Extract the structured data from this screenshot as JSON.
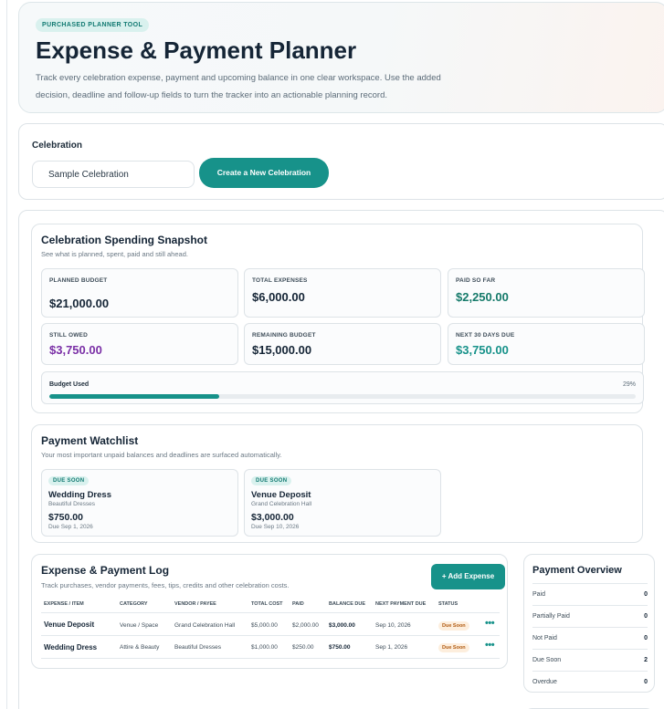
{
  "hero": {
    "pill": "PURCHASED PLANNER TOOL",
    "title": "Expense & Payment Planner",
    "description": "Track every celebration expense, payment and upcoming balance in one clear workspace. Use the added decision, deadline and follow-up fields to turn the tracker into an actionable planning record."
  },
  "celebration": {
    "label": "Celebration",
    "selected": "Sample Celebration",
    "create_button": "Create a New Celebration"
  },
  "snapshot": {
    "title": "Celebration Spending Snapshot",
    "subtitle": "See what is planned, spent, paid and still ahead.",
    "stats": [
      {
        "label": "PLANNED BUDGET",
        "value": "$21,000.00",
        "color": "#152536"
      },
      {
        "label": "TOTAL EXPENSES",
        "value": "$6,000.00",
        "color": "#152536"
      },
      {
        "label": "PAID SO FAR",
        "value": "$2,250.00",
        "color": "#157a6a"
      },
      {
        "label": "STILL OWED",
        "value": "$3,750.00",
        "color": "#7a2fa6"
      },
      {
        "label": "REMAINING BUDGET",
        "value": "$15,000.00",
        "color": "#152536"
      },
      {
        "label": "NEXT 30 DAYS DUE",
        "value": "$3,750.00",
        "color": "#17928a"
      }
    ],
    "budget_label": "Budget Used",
    "budget_pct_text": "29%",
    "budget_used_fraction": 0.29
  },
  "watchlist": {
    "title": "Payment Watchlist",
    "subtitle": "Your most important unpaid balances and deadlines are surfaced automatically.",
    "items": [
      {
        "badge": "DUE SOON",
        "name": "Wedding Dress",
        "vendor": "Beautiful Dresses",
        "amount": "$750.00",
        "due": "Due Sep 1, 2026"
      },
      {
        "badge": "DUE SOON",
        "name": "Venue Deposit",
        "vendor": "Grand Celebration Hall",
        "amount": "$3,000.00",
        "due": "Due Sep 10, 2026"
      }
    ]
  },
  "log": {
    "title": "Expense & Payment Log",
    "subtitle": "Track purchases, vendor payments, fees, tips, credits and other celebration costs.",
    "add_button": "+ Add Expense",
    "columns": [
      "EXPENSE / ITEM",
      "CATEGORY",
      "VENDOR / PAYEE",
      "TOTAL COST",
      "PAID",
      "BALANCE DUE",
      "NEXT PAYMENT DUE",
      "STATUS"
    ],
    "rows": [
      {
        "item": "Venue Deposit",
        "category": "Venue / Space",
        "vendor": "Grand Celebration Hall",
        "total": "$5,000.00",
        "paid": "$2,000.00",
        "balance": "$3,000.00",
        "next_due": "Sep 10, 2026",
        "status": "Due Soon",
        "more": "•••"
      },
      {
        "item": "Wedding Dress",
        "category": "Attire & Beauty",
        "vendor": "Beautiful Dresses",
        "total": "$1,000.00",
        "paid": "$250.00",
        "balance": "$750.00",
        "next_due": "Sep 1, 2026",
        "status": "Due Soon",
        "more": "•••"
      }
    ]
  },
  "overview": {
    "title": "Payment Overview",
    "rows": [
      {
        "label": "Paid",
        "value": "0"
      },
      {
        "label": "Partially Paid",
        "value": "0"
      },
      {
        "label": "Not Paid",
        "value": "0"
      },
      {
        "label": "Due Soon",
        "value": "2"
      },
      {
        "label": "Overdue",
        "value": "0"
      }
    ]
  }
}
